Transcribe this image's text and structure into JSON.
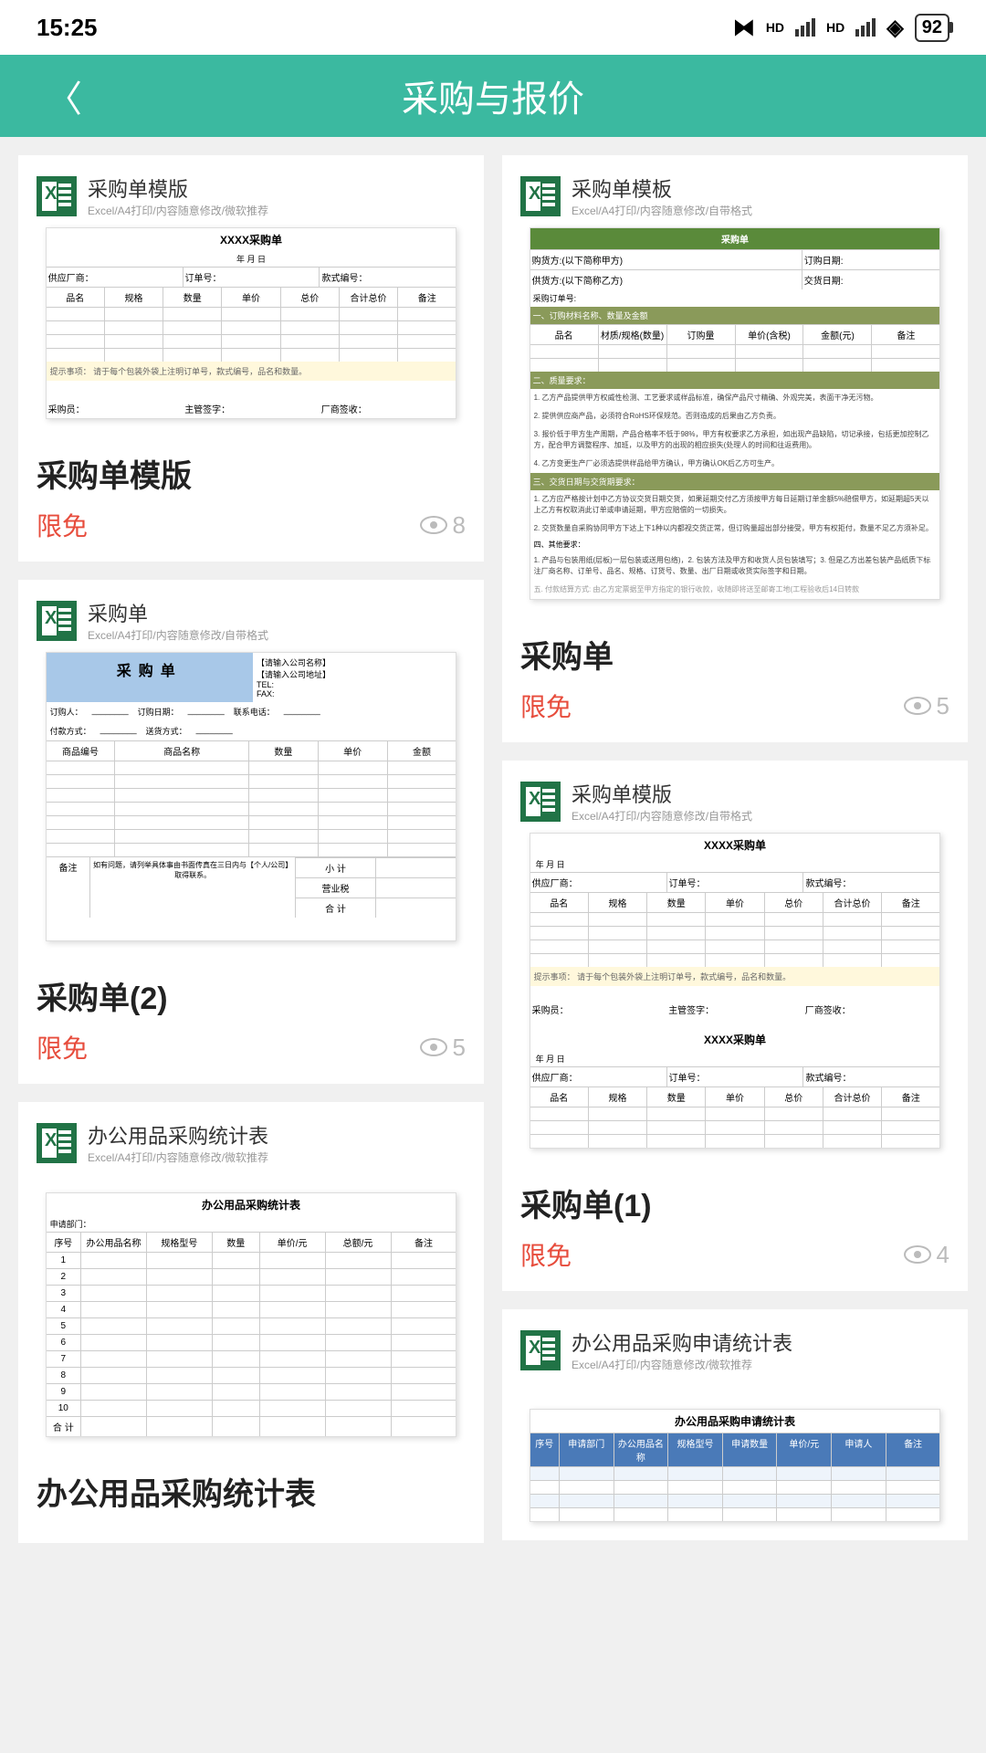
{
  "status": {
    "time": "15:25",
    "battery": "92",
    "hd_label": "HD"
  },
  "header": {
    "title": "采购与报价"
  },
  "common": {
    "price_tag": "限免",
    "doc_sub_full": "Excel/A4打印/内容随意修改/自带格式",
    "doc_sub_ms": "Excel/A4打印/内容随意修改/微软推荐"
  },
  "cards": {
    "c1": {
      "preview_title": "采购单模版",
      "sheet_title": "XXXX采购单",
      "title": "采购单模版",
      "views": "8"
    },
    "c2": {
      "preview_title": "采购单模板",
      "sheet_title": "采购单",
      "title": "采购单",
      "views": "5"
    },
    "c3": {
      "preview_title": "采购单",
      "sheet_title": "采购单",
      "title": "采购单(2)",
      "views": "5"
    },
    "c4": {
      "preview_title": "采购单模版",
      "sheet_title": "XXXX采购单",
      "title": "采购单(1)",
      "views": "4"
    },
    "c5": {
      "preview_title": "办公用品采购统计表",
      "sheet_title": "办公用品采购统计表",
      "title": "办公用品采购统计表"
    },
    "c6": {
      "preview_title": "办公用品采购申请统计表",
      "sheet_title": "办公用品采购申请统计表"
    }
  },
  "sheet_labels": {
    "date": "年 月 日",
    "supplier": "供应厂商：",
    "order_no": "订单号：",
    "style_no": "款式编号：",
    "col_name": "品名",
    "col_spec": "规格",
    "col_qty": "数量",
    "col_unit": "单价",
    "col_total": "总价",
    "col_sum": "合计总价",
    "col_note": "备注",
    "note_text": "提示事项：   请于每个包装外袋上注明订单号，款式编号，品名和数量。",
    "purchaser": "采购员：",
    "manager": "主管签字：",
    "vendor": "厂商签收：",
    "buyer_side": "购货方:(以下简称甲方)",
    "seller_side": "供货方:(以下简称乙方)",
    "order_date": "订购日期:",
    "delivery_date": "交货日期:",
    "po_no": "采购订单号:",
    "order_info": "一、订购材料名称、数量及金额",
    "col_mat": "材质/规格(数量)",
    "col_qty2": "订购量",
    "col_price": "单价(含税)",
    "col_amt": "金额(元)",
    "quality_req": "二、质量要求：",
    "q1": "1. 乙方产品提供甲方权威性检测、工艺要求或样品标准，确保产品尺寸精确、外观完美，表面干净无污物。",
    "q2": "2. 提供供应商产品，必须符合RoHS环保规范。否则造成的后果由乙方负责。",
    "q3": "3. 报价低于甲方生产周期，产品合格率不低于98%，甲方有权要求乙方承担，如出现产品缺陷，切记承接，包括更加控制乙方，配合甲方调整程序、加班，以及甲方的出现的相应损失(处理人的时间和往返费用)。",
    "q4": "4. 乙方变更生产厂必须选提供样品给甲方确认，甲方确认OK后乙方可生产。",
    "delivery_req": "三、交货日期与交货期要求：",
    "d1": "1. 乙方应严格按计划中乙方协议交货日期交货，如果延期交付乙方须按甲方每日延期订单金额5%赔偿甲方，如延期超5天以上乙方有权取消此订单或申请延期，甲方应赔偿的一切损失。",
    "d2": "2. 交货数量自采购协同甲方下达上下1种以内都视交货正常，但订购量超出部分接受，甲方有权拒付，数量不足乙方须补足。",
    "other": "四、其他要求：",
    "o1": "1. 产品与包装用纸(层板)一层包装或送用包络)，2. 包装方法及甲方和收货人员包装填写；3. 但是乙方出差包装产品纸质下标注厂商名称、订单号、品名、规格、订货号、数量、出厂日期或收货实际签字和日期。",
    "bank": "五. 付款结算方式:   由乙方定票据至甲方指定的银行收款，收随即将送至邮寄工地(工程验收后14日转款",
    "company_name": "【请输入公司名称】",
    "company_addr": "【请输入公司地址】",
    "tel": "TEL:",
    "fax": "FAX:",
    "orderer": "订购人：",
    "order_date2": "订购日期：",
    "contact": "联系电话：",
    "pay_method": "付款方式：",
    "ship_method": "送货方式：",
    "pcol_code": "商品编号",
    "pcol_name": "商品名称",
    "pcol_qty": "数量",
    "pcol_price": "单价",
    "pcol_amt": "金额",
    "remark": "备注",
    "remark_text": "如有问题，请列举具体事由书面传真在三日内与【个人/公司】取得联系。",
    "subtotal": "小 计",
    "tax": "营业税",
    "total": "合 计",
    "dept": "申请部门：",
    "tcol_no": "序号",
    "tcol_name": "办公用品名称",
    "tcol_spec": "规格型号",
    "tcol_qty": "数量",
    "tcol_price": "单价/元",
    "tcol_amt": "总额/元",
    "tcol_note": "备注",
    "acol_no": "序号",
    "acol_dept": "申请部门",
    "acol_name": "办公用品名称",
    "acol_spec": "规格型号",
    "acol_qty": "申请数量",
    "acol_price": "单价/元",
    "acol_person": "申请人",
    "acol_note": "备注"
  }
}
